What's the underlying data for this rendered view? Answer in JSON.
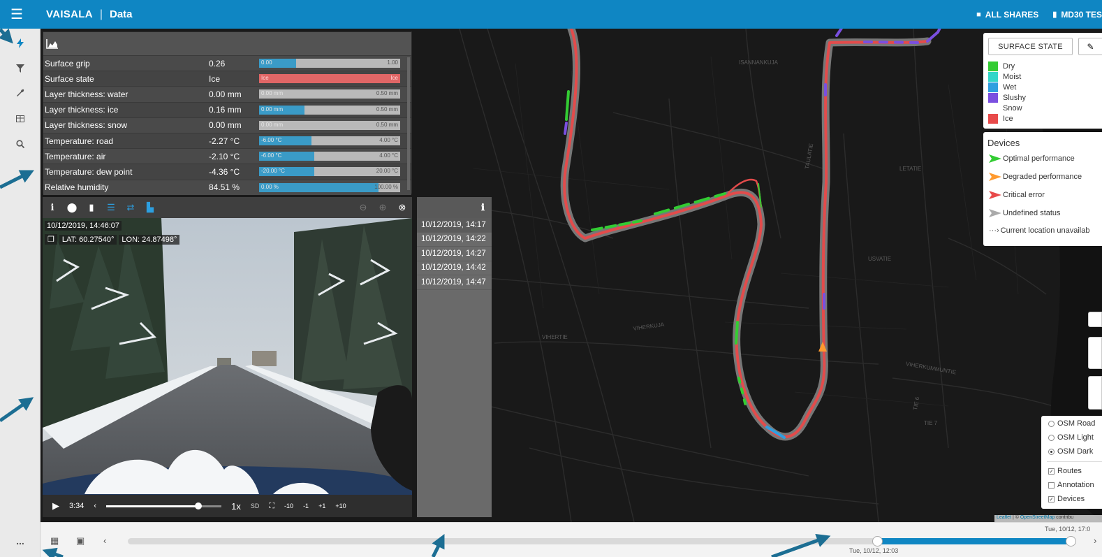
{
  "header": {
    "brand": "VAISALA",
    "separator": "|",
    "title": "Data",
    "right_items": [
      {
        "icon": "folder-icon",
        "label": "ALL SHARES"
      },
      {
        "icon": "device-icon",
        "label": "MD30 TES"
      }
    ]
  },
  "sidebar": {
    "items": [
      {
        "name": "bolt-icon",
        "active": true
      },
      {
        "name": "filter-icon",
        "active": false
      },
      {
        "name": "wrench-icon",
        "active": false
      },
      {
        "name": "table-icon",
        "active": false
      },
      {
        "name": "search-icon",
        "active": false
      }
    ],
    "more": "..."
  },
  "data_panel": {
    "header_icon": "area-chart-icon",
    "rows": [
      {
        "label": "Surface grip",
        "value": "0.26",
        "min": "0.00",
        "max": "1.00",
        "fraction": 0.26,
        "color": "#3a9bc7"
      },
      {
        "label": "Surface state",
        "value": "Ice",
        "min": "Ice",
        "max": "Ice",
        "fraction": 1.0,
        "color": "#e06666"
      },
      {
        "label": "Layer thickness: water",
        "value": "0.00 mm",
        "min": "0.00 mm",
        "max": "0.50 mm",
        "fraction": 0.0,
        "color": "#3a9bc7"
      },
      {
        "label": "Layer thickness: ice",
        "value": "0.16 mm",
        "min": "0.00 mm",
        "max": "0.50 mm",
        "fraction": 0.32,
        "color": "#3a9bc7"
      },
      {
        "label": "Layer thickness: snow",
        "value": "0.00 mm",
        "min": "0.00 mm",
        "max": "0.50 mm",
        "fraction": 0.0,
        "color": "#3a9bc7"
      },
      {
        "label": "Temperature: road",
        "value": "-2.27 °C",
        "min": "-6.00 °C",
        "max": "4.00 °C",
        "fraction": 0.373,
        "color": "#3a9bc7"
      },
      {
        "label": "Temperature: air",
        "value": "-2.10 °C",
        "min": "-6.00 °C",
        "max": "4.00 °C",
        "fraction": 0.39,
        "color": "#3a9bc7"
      },
      {
        "label": "Temperature: dew point",
        "value": "-4.36 °C",
        "min": "-20.00 °C",
        "max": "20.00 °C",
        "fraction": 0.391,
        "color": "#3a9bc7"
      },
      {
        "label": "Relative humidity",
        "value": "84.51 %",
        "min": "0.00 %",
        "max": "100.00 %",
        "fraction": 0.845,
        "color": "#3a9bc7"
      }
    ]
  },
  "video_panel": {
    "timestamp": "10/12/2019, 14:46:07",
    "lat": "LAT: 60.27540°",
    "lon": "LON: 24.87498°",
    "time": "3:34",
    "progress": 0.8,
    "speed": "1x",
    "quality": "SD",
    "skip": [
      "-10",
      "-1",
      "+1",
      "+10"
    ]
  },
  "timestamps": [
    "10/12/2019, 14:17",
    "10/12/2019, 14:22",
    "10/12/2019, 14:27",
    "10/12/2019, 14:42",
    "10/12/2019, 14:47"
  ],
  "legend": {
    "button": "SURFACE STATE",
    "items": [
      {
        "label": "Dry",
        "color": "#33cc33"
      },
      {
        "label": "Moist",
        "color": "#33d6c8"
      },
      {
        "label": "Wet",
        "color": "#2f9fe0"
      },
      {
        "label": "Slushy",
        "color": "#7a4fe0"
      },
      {
        "label": "Snow",
        "color": "#ffffff"
      },
      {
        "label": "Ice",
        "color": "#e84a4a"
      }
    ]
  },
  "devices": {
    "title": "Devices",
    "items": [
      {
        "label": "Optimal performance",
        "color": "#33cc33"
      },
      {
        "label": "Degraded performance",
        "color": "#ff9a2e"
      },
      {
        "label": "Critical error",
        "color": "#e84a4a"
      },
      {
        "label": "Undefined status",
        "color": "#aaaaaa"
      },
      {
        "label": "Current location unavailab",
        "color": "#555555"
      }
    ]
  },
  "layers": {
    "base": [
      {
        "label": "OSM Road",
        "selected": false
      },
      {
        "label": "OSM Light",
        "selected": false
      },
      {
        "label": "OSM Dark",
        "selected": true
      }
    ],
    "overlays": [
      {
        "label": "Routes",
        "checked": true
      },
      {
        "label": "Annotation",
        "checked": false
      },
      {
        "label": "Devices",
        "checked": true
      }
    ]
  },
  "attribution": {
    "leaflet": "Leaflet",
    "sep": " | © ",
    "osm": "OpenStreetMap",
    "rest": " contribu"
  },
  "timeline": {
    "start_label": "Tue, 10/12, 12:03",
    "end_label": "Tue, 10/12, 17:0",
    "selection_start": 0.795,
    "selection_end": 1.0
  },
  "map_labels": [
    "ISANNANKUJA",
    "TAULATIE",
    "LETATIE",
    "USVATIE",
    "VIHERTIE",
    "VIHERKUJA",
    "VIHERKUMMUNTIE",
    "TIE 7",
    "TIE 6"
  ]
}
